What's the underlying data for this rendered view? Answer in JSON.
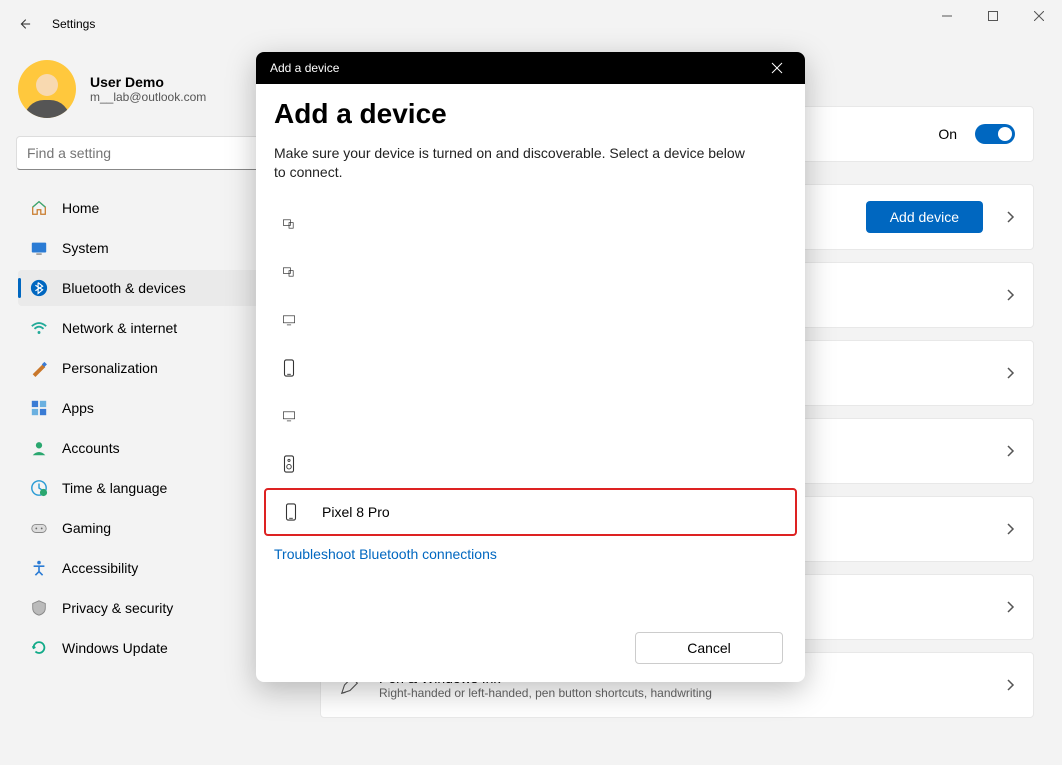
{
  "window": {
    "title": "Settings"
  },
  "profile": {
    "name": "User Demo",
    "email": "m__lab@outlook.com"
  },
  "search": {
    "placeholder": "Find a setting"
  },
  "nav": {
    "items": [
      {
        "id": "home",
        "label": "Home"
      },
      {
        "id": "system",
        "label": "System"
      },
      {
        "id": "bluetooth",
        "label": "Bluetooth & devices"
      },
      {
        "id": "network",
        "label": "Network & internet"
      },
      {
        "id": "personalization",
        "label": "Personalization"
      },
      {
        "id": "apps",
        "label": "Apps"
      },
      {
        "id": "accounts",
        "label": "Accounts"
      },
      {
        "id": "time",
        "label": "Time & language"
      },
      {
        "id": "gaming",
        "label": "Gaming"
      },
      {
        "id": "accessibility",
        "label": "Accessibility"
      },
      {
        "id": "privacy",
        "label": "Privacy & security"
      },
      {
        "id": "update",
        "label": "Windows Update"
      }
    ],
    "active": "bluetooth"
  },
  "main": {
    "bluetooth_toggle": {
      "label": "On",
      "state": true
    },
    "add_device_button": "Add device",
    "pen_row": {
      "title": "Pen & Windows Ink",
      "subtitle": "Right-handed or left-handed, pen button shortcuts, handwriting"
    }
  },
  "modal": {
    "titlebar": "Add a device",
    "heading": "Add a device",
    "subtitle": "Make sure your device is turned on and discoverable. Select a device below to connect.",
    "devices": [
      {
        "icon": "devices",
        "label": ""
      },
      {
        "icon": "devices",
        "label": ""
      },
      {
        "icon": "monitor",
        "label": ""
      },
      {
        "icon": "phone",
        "label": ""
      },
      {
        "icon": "monitor",
        "label": ""
      },
      {
        "icon": "speaker",
        "label": ""
      },
      {
        "icon": "phone",
        "label": "Pixel 8 Pro",
        "highlight": true
      }
    ],
    "troubleshoot": "Troubleshoot Bluetooth connections",
    "cancel": "Cancel"
  }
}
